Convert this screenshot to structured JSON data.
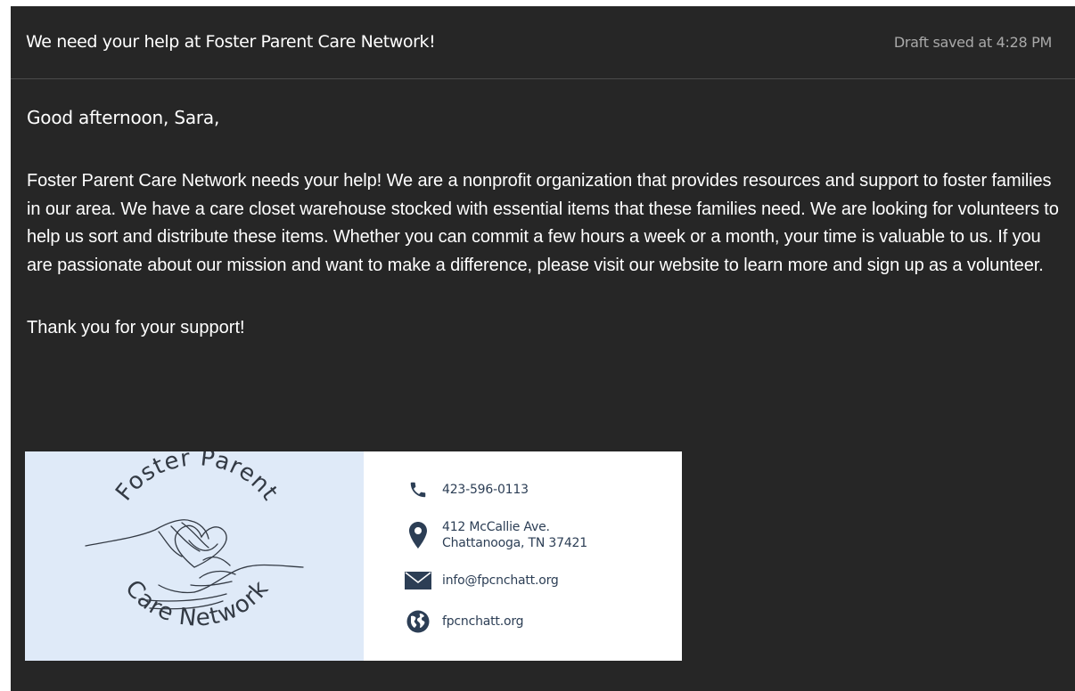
{
  "header": {
    "subject": "We need your help at Foster Parent Care Network!",
    "draft_status": "Draft saved at 4:28 PM"
  },
  "message": {
    "greeting": "Good afternoon, Sara,",
    "paragraph": "Foster Parent Care Network needs your help! We are a nonprofit organization that provides resources and support to foster families in our area. We have a care closet warehouse stocked with essential items that these families need. We are looking for volunteers to help us sort and distribute these items. Whether you can commit a few hours a week or a month, your time is valuable to us. If you are passionate about our mission and want to make a difference, please visit our website to learn more and sign up as a volunteer.",
    "closing": "Thank you for your support!"
  },
  "signature": {
    "logo": {
      "top_text": "Foster Parent",
      "bottom_text": "Care Network"
    },
    "phone": "423-596-0113",
    "address_line1": "412 McCallie Ave.",
    "address_line2": "Chattanooga, TN 37421",
    "email": "info@fpcnchatt.org",
    "website": "fpcnchatt.org",
    "icons": {
      "phone": "phone-icon",
      "address": "map-pin-icon",
      "email": "envelope-icon",
      "website": "globe-icon"
    },
    "colors": {
      "icon": "#2c3e55",
      "logo_background": "#dfeaf8"
    }
  },
  "theme": {
    "background": "#262626",
    "text": "#ffffff",
    "muted_text": "#a9a9a9"
  }
}
